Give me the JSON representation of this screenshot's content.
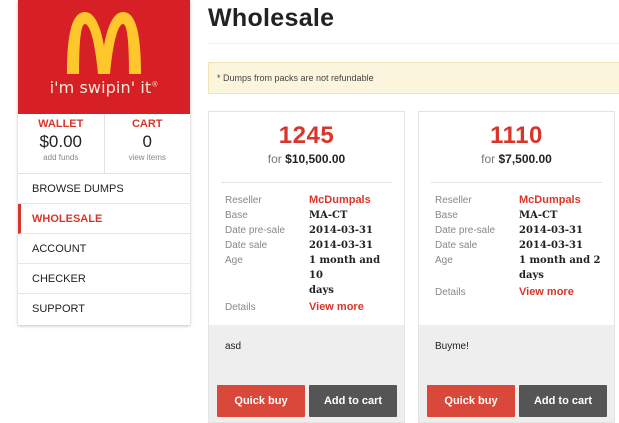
{
  "brand": {
    "slogan": "i'm swipin' it",
    "slogan_mark": "®"
  },
  "colors": {
    "accent": "#d9362b",
    "logo_bg": "#d71f26",
    "logo_m": "#ffc72c",
    "button_dark": "#555555",
    "notice_bg": "#fcf5dd"
  },
  "sidebar": {
    "wallet": {
      "title": "WALLET",
      "value": "$0.00",
      "sub": "add funds"
    },
    "cart": {
      "title": "CART",
      "value": "0",
      "sub": "view items"
    },
    "items": [
      {
        "label": "BROWSE DUMPS",
        "active": false
      },
      {
        "label": "WHOLESALE",
        "active": true
      },
      {
        "label": "ACCOUNT",
        "active": false
      },
      {
        "label": "CHECKER",
        "active": false
      },
      {
        "label": "SUPPORT",
        "active": false
      }
    ]
  },
  "main": {
    "title": "Wholesale",
    "notice": "* Dumps from packs are not refundable",
    "cards": [
      {
        "count": "1245",
        "price_prefix": "for ",
        "price": "$10,500.00",
        "labels": {
          "reseller": "Reseller",
          "base": "Base",
          "date_presale": "Date pre-sale",
          "date_sale": "Date sale",
          "age": "Age",
          "details": "Details"
        },
        "reseller": "McDumpals",
        "base": "MA-CT",
        "date_presale": "2014-03-31",
        "date_sale": "2014-03-31",
        "age_line1": "1 month and 10",
        "age_line2": "days",
        "details_link": "View more",
        "description": "asd",
        "quick_buy": "Quick buy",
        "add_to_cart": "Add to cart"
      },
      {
        "count": "1110",
        "price_prefix": "for ",
        "price": "$7,500.00",
        "labels": {
          "reseller": "Reseller",
          "base": "Base",
          "date_presale": "Date pre-sale",
          "date_sale": "Date sale",
          "age": "Age",
          "details": "Details"
        },
        "reseller": "McDumpals",
        "base": "MA-CT",
        "date_presale": "2014-03-31",
        "date_sale": "2014-03-31",
        "age_line1": "1 month and 2",
        "age_line2": "days",
        "details_link": "View more",
        "description": "Buyme!",
        "quick_buy": "Quick buy",
        "add_to_cart": "Add to cart"
      }
    ]
  }
}
